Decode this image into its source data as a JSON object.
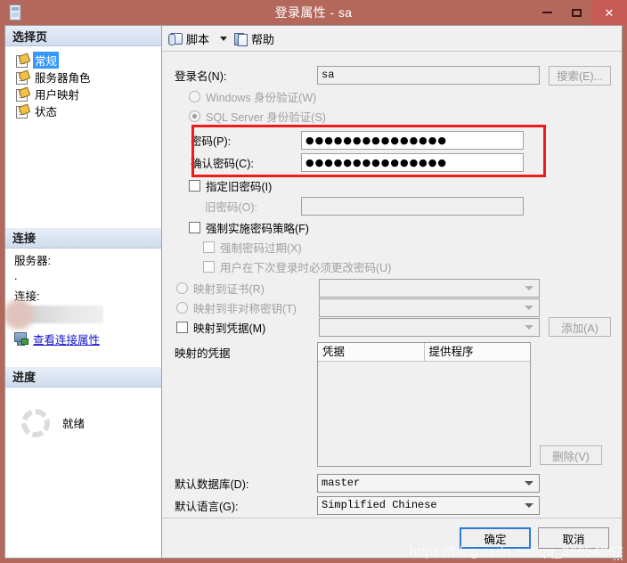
{
  "window": {
    "title": "登录属性 - sa",
    "icon": "login-properties-icon",
    "minimize_label": "最小化",
    "maximize_label": "最大化",
    "close_label": "关闭",
    "titlebar_color": "#b4685c",
    "close_button_color": "#c85a55"
  },
  "sidebar": {
    "pages_header": "选择页",
    "pages": [
      {
        "label": "常规",
        "selected": true
      },
      {
        "label": "服务器角色",
        "selected": false
      },
      {
        "label": "用户映射",
        "selected": false
      },
      {
        "label": "状态",
        "selected": false
      }
    ],
    "connection_header": "连接",
    "server_label": "服务器:",
    "server_value": ".",
    "connection_label": "连接:",
    "connection_value": "",
    "view_connection_properties": "查看连接属性",
    "progress_header": "进度",
    "progress_status": "就绪",
    "selection_color": "#3399ff"
  },
  "toolbar": {
    "script_label": "脚本",
    "help_label": "帮助"
  },
  "form": {
    "login_name_label": "登录名(N):",
    "login_name_value": "sa",
    "search_button": "搜索(E)...",
    "windows_auth_label": "Windows 身份验证(W)",
    "sql_auth_label": "SQL Server 身份验证(S)",
    "password_label": "密码(P):",
    "password_value": "●●●●●●●●●●●●●●●",
    "confirm_password_label": "确认密码(C):",
    "confirm_password_value": "●●●●●●●●●●●●●●●",
    "specify_old_password_label": "指定旧密码(I)",
    "old_password_label": "旧密码(O):",
    "old_password_value": "",
    "enforce_policy_label": "强制实施密码策略(F)",
    "enforce_expiration_label": "强制密码过期(X)",
    "must_change_label": "用户在下次登录时必须更改密码(U)",
    "map_certificate_label": "映射到证书(R)",
    "map_certificate_value": "",
    "map_asymmetric_key_label": "映射到非对称密钥(T)",
    "map_asymmetric_key_value": "",
    "map_credential_label": "映射到凭据(M)",
    "map_credential_value": "",
    "add_button": "添加(A)",
    "mapped_credentials_label": "映射的凭据",
    "grid_columns": [
      "凭据",
      "提供程序"
    ],
    "grid_rows": [],
    "remove_button": "删除(V)",
    "default_database_label": "默认数据库(D):",
    "default_database_value": "master",
    "default_language_label": "默认语言(G):",
    "default_language_value": "Simplified Chinese",
    "highlight_color": "#f01c1c"
  },
  "footer": {
    "ok_label": "确定",
    "cancel_label": "取消"
  },
  "watermark": {
    "text": "https://blog.csdn.net/qq_36654367"
  }
}
